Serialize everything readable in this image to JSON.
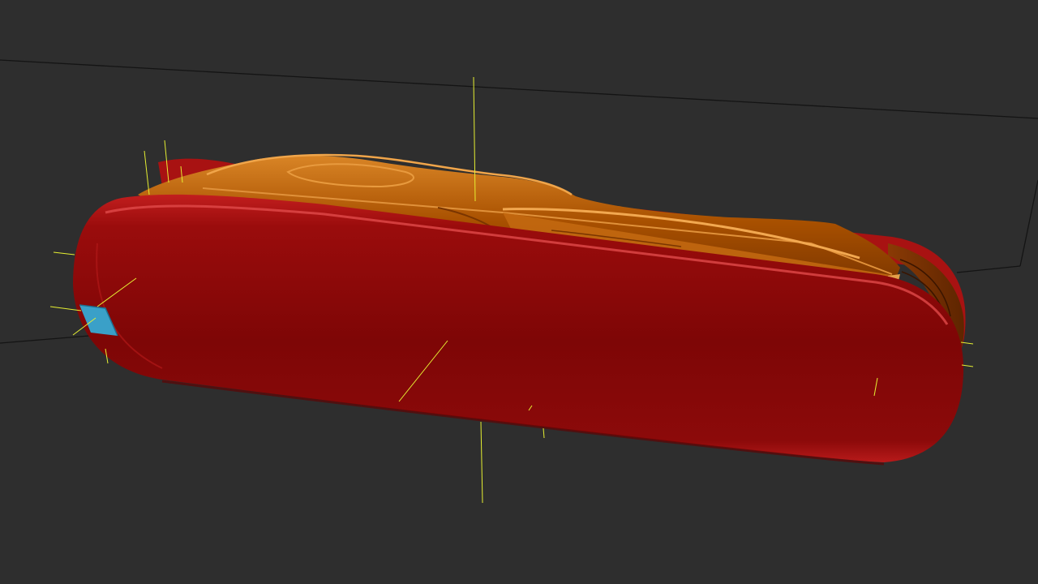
{
  "viewport": {
    "background_color": "#2e2e2e",
    "grid_line_color": "#111111",
    "manipulator_color": "#e6f032"
  },
  "model": {
    "body_color": "#8a0a0a",
    "body_highlight_color": "#d83838",
    "tools_color": "#b85a00",
    "tools_highlight_color": "#e3902a",
    "marker_color": "#3aa0c8"
  },
  "icons": {
    "pivot": "pivot-icon",
    "marker": "blue-marker-icon"
  }
}
